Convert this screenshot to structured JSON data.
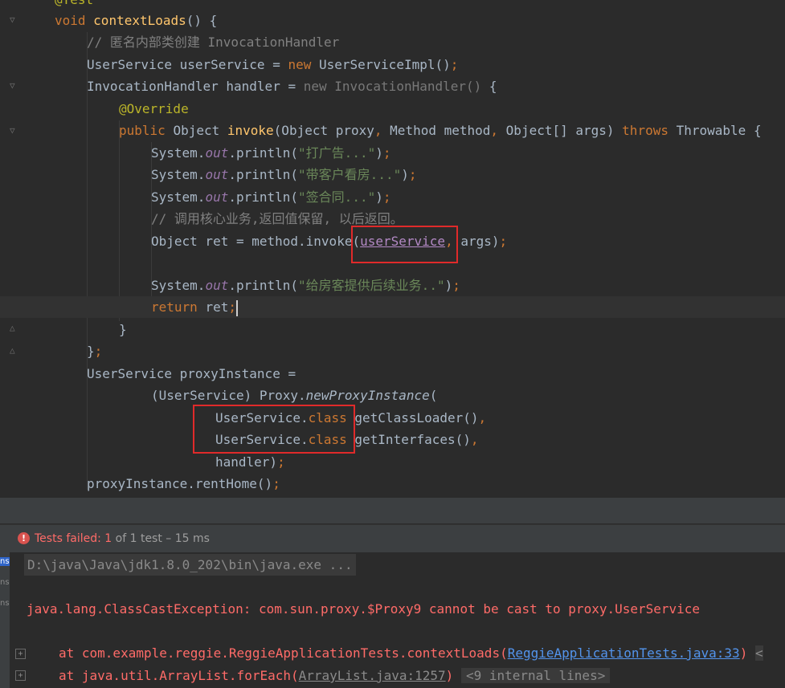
{
  "editor": {
    "lines": [
      {
        "t": [
          [
            "an",
            "@Test"
          ]
        ]
      },
      {
        "t": [
          [
            "kw",
            "void "
          ],
          [
            "fn",
            "contextLoads"
          ],
          [
            "",
            "() {"
          ]
        ]
      },
      {
        "t": [
          [
            "cm",
            "// 匿名内部类创建 InvocationHandler"
          ]
        ]
      },
      {
        "t": [
          [
            "",
            "UserService userService = "
          ],
          [
            "kw",
            "new "
          ],
          [
            "",
            "UserServiceImpl()"
          ],
          [
            "kw",
            ";"
          ]
        ]
      },
      {
        "t": [
          [
            "",
            "InvocationHandler handler = "
          ],
          [
            "dimkw",
            "new "
          ],
          [
            "dim",
            "InvocationHandler()"
          ],
          [
            "",
            " {"
          ]
        ]
      },
      {
        "t": [
          [
            "an",
            "@Override"
          ]
        ]
      },
      {
        "t": [
          [
            "kw",
            "public "
          ],
          [
            "",
            "Object "
          ],
          [
            "fn",
            "invoke"
          ],
          [
            "",
            "(Object proxy"
          ],
          [
            "kw",
            ", "
          ],
          [
            "",
            "Method method"
          ],
          [
            "kw",
            ", "
          ],
          [
            "",
            "Object[] args) "
          ],
          [
            "kw",
            "throws "
          ],
          [
            "",
            "Throwable {"
          ]
        ]
      },
      {
        "t": [
          [
            "",
            "System."
          ],
          [
            "sf",
            "out"
          ],
          [
            "",
            ".println("
          ],
          [
            "st",
            "\"打广告...\""
          ],
          [
            "",
            ")"
          ],
          [
            "kw",
            ";"
          ]
        ]
      },
      {
        "t": [
          [
            "",
            "System."
          ],
          [
            "sf",
            "out"
          ],
          [
            "",
            ".println("
          ],
          [
            "st",
            "\"带客户看房...\""
          ],
          [
            "",
            ")"
          ],
          [
            "kw",
            ";"
          ]
        ]
      },
      {
        "t": [
          [
            "",
            "System."
          ],
          [
            "sf",
            "out"
          ],
          [
            "",
            ".println("
          ],
          [
            "st",
            "\"签合同...\""
          ],
          [
            "",
            ")"
          ],
          [
            "kw",
            ";"
          ]
        ]
      },
      {
        "t": [
          [
            "cm",
            "// 调用核心业务,返回值保留, 以后返回。"
          ]
        ]
      },
      {
        "t": [
          [
            "",
            "Object ret = method.invoke("
          ],
          [
            "pv",
            "userService"
          ],
          [
            "kw",
            ", "
          ],
          [
            "",
            "args)"
          ],
          [
            "kw",
            ";"
          ]
        ]
      },
      {
        "t": []
      },
      {
        "t": [
          [
            "",
            "System."
          ],
          [
            "sf",
            "out"
          ],
          [
            "",
            ".println("
          ],
          [
            "st",
            "\"给房客提供后续业务..\""
          ],
          [
            "",
            ")"
          ],
          [
            "kw",
            ";"
          ]
        ]
      },
      {
        "t": [
          [
            "kw",
            "return "
          ],
          [
            "",
            "ret"
          ],
          [
            "kw",
            ";"
          ]
        ]
      },
      {
        "t": [
          [
            "",
            "}"
          ]
        ]
      },
      {
        "t": [
          [
            "",
            "}"
          ],
          [
            "kw",
            ";"
          ]
        ]
      },
      {
        "t": [
          [
            "",
            "UserService proxyInstance ="
          ]
        ]
      },
      {
        "t": [
          [
            "",
            "(UserService) Proxy."
          ],
          [
            "it",
            "newProxyInstance"
          ],
          [
            "",
            "("
          ]
        ]
      },
      {
        "t": [
          [
            "",
            "UserService."
          ],
          [
            "kw",
            "class"
          ],
          [
            "",
            " getClassLoader()"
          ],
          [
            "kw",
            ","
          ]
        ]
      },
      {
        "t": [
          [
            "",
            "UserService."
          ],
          [
            "kw",
            "class"
          ],
          [
            "",
            " getInterfaces()"
          ],
          [
            "kw",
            ","
          ]
        ]
      },
      {
        "t": [
          [
            "",
            "handler)"
          ],
          [
            "kw",
            ";"
          ]
        ]
      },
      {
        "t": [
          [
            "",
            "proxyInstance.rentHome()"
          ],
          [
            "kw",
            ";"
          ]
        ]
      }
    ]
  },
  "status": {
    "failed_label": "Tests failed:",
    "count": "1",
    "rest": "of 1 test – 15 ms"
  },
  "console": {
    "side_labels": [
      "ns",
      "ns",
      "ns"
    ],
    "java_cmd": "D:\\java\\Java\\jdk1.8.0_202\\bin\\java.exe ...",
    "exception": "java.lang.ClassCastException: com.sun.proxy.$Proxy9 cannot be cast to proxy.UserService",
    "trace1_pre": "at com.example.reggie.ReggieApplicationTests.contextLoads(",
    "trace1_link": "ReggieApplicationTests.java:33",
    "trace1_post": ")",
    "trace1_more": "<",
    "trace2_pre": "at java.util.ArrayList.forEach(",
    "trace2_link": "ArrayList.java:1257",
    "trace2_post": ")",
    "trace2_internal": "<9 internal lines>"
  },
  "colors": {
    "highlight_box": "#e02a2a",
    "error": "#ff6b68",
    "link": "#5394ec"
  }
}
